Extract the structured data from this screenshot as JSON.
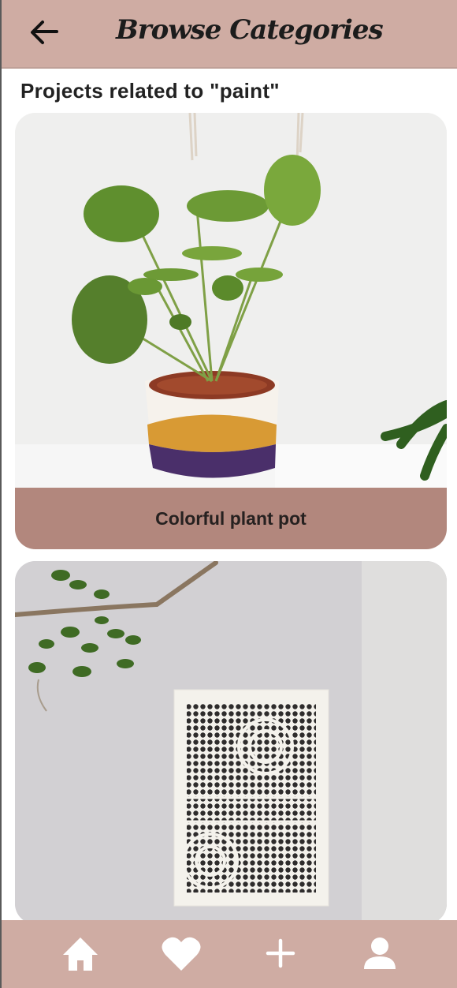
{
  "header": {
    "title": "Browse Categories",
    "back_icon": "arrow-left-icon"
  },
  "page": {
    "subtitle": "Projects related to \"paint\""
  },
  "projects": [
    {
      "title": "Colorful plant pot",
      "image": "monstera-plant-in-painted-pot"
    },
    {
      "title": "",
      "image": "dot-art-print-on-wall"
    }
  ],
  "bottom_nav": {
    "items": [
      {
        "icon": "home-icon"
      },
      {
        "icon": "heart-icon"
      },
      {
        "icon": "plus-icon"
      },
      {
        "icon": "user-icon"
      }
    ]
  },
  "colors": {
    "header_bg": "#cfaca3",
    "caption_bg": "#b2877d",
    "nav_bg": "#cfaca3"
  }
}
